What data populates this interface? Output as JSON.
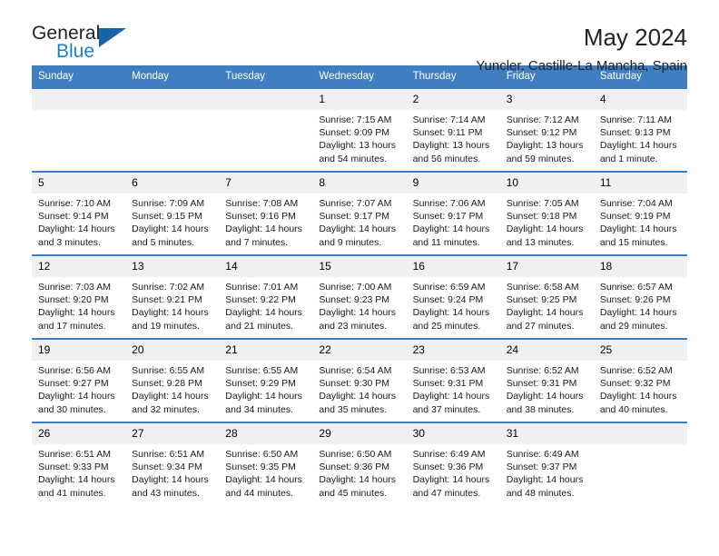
{
  "brand": {
    "name_part1": "General",
    "name_part2": "Blue"
  },
  "header": {
    "title": "May 2024",
    "subtitle": "Yuncler, Castille-La Mancha, Spain"
  },
  "colors": {
    "header_blue": "#3f7fc1",
    "logo_blue": "#1d7fc3",
    "triangle_blue": "#1665ab",
    "daynum_band": "#f0f0f0"
  },
  "calendar": {
    "weekday_headers": [
      "Sunday",
      "Monday",
      "Tuesday",
      "Wednesday",
      "Thursday",
      "Friday",
      "Saturday"
    ],
    "weeks": [
      [
        {
          "day": "",
          "sunrise": "",
          "sunset": "",
          "daylight": "",
          "empty": true
        },
        {
          "day": "",
          "sunrise": "",
          "sunset": "",
          "daylight": "",
          "empty": true
        },
        {
          "day": "",
          "sunrise": "",
          "sunset": "",
          "daylight": "",
          "empty": true
        },
        {
          "day": "1",
          "sunrise": "Sunrise: 7:15 AM",
          "sunset": "Sunset: 9:09 PM",
          "daylight": "Daylight: 13 hours and 54 minutes."
        },
        {
          "day": "2",
          "sunrise": "Sunrise: 7:14 AM",
          "sunset": "Sunset: 9:11 PM",
          "daylight": "Daylight: 13 hours and 56 minutes."
        },
        {
          "day": "3",
          "sunrise": "Sunrise: 7:12 AM",
          "sunset": "Sunset: 9:12 PM",
          "daylight": "Daylight: 13 hours and 59 minutes."
        },
        {
          "day": "4",
          "sunrise": "Sunrise: 7:11 AM",
          "sunset": "Sunset: 9:13 PM",
          "daylight": "Daylight: 14 hours and 1 minute."
        }
      ],
      [
        {
          "day": "5",
          "sunrise": "Sunrise: 7:10 AM",
          "sunset": "Sunset: 9:14 PM",
          "daylight": "Daylight: 14 hours and 3 minutes."
        },
        {
          "day": "6",
          "sunrise": "Sunrise: 7:09 AM",
          "sunset": "Sunset: 9:15 PM",
          "daylight": "Daylight: 14 hours and 5 minutes."
        },
        {
          "day": "7",
          "sunrise": "Sunrise: 7:08 AM",
          "sunset": "Sunset: 9:16 PM",
          "daylight": "Daylight: 14 hours and 7 minutes."
        },
        {
          "day": "8",
          "sunrise": "Sunrise: 7:07 AM",
          "sunset": "Sunset: 9:17 PM",
          "daylight": "Daylight: 14 hours and 9 minutes."
        },
        {
          "day": "9",
          "sunrise": "Sunrise: 7:06 AM",
          "sunset": "Sunset: 9:17 PM",
          "daylight": "Daylight: 14 hours and 11 minutes."
        },
        {
          "day": "10",
          "sunrise": "Sunrise: 7:05 AM",
          "sunset": "Sunset: 9:18 PM",
          "daylight": "Daylight: 14 hours and 13 minutes."
        },
        {
          "day": "11",
          "sunrise": "Sunrise: 7:04 AM",
          "sunset": "Sunset: 9:19 PM",
          "daylight": "Daylight: 14 hours and 15 minutes."
        }
      ],
      [
        {
          "day": "12",
          "sunrise": "Sunrise: 7:03 AM",
          "sunset": "Sunset: 9:20 PM",
          "daylight": "Daylight: 14 hours and 17 minutes."
        },
        {
          "day": "13",
          "sunrise": "Sunrise: 7:02 AM",
          "sunset": "Sunset: 9:21 PM",
          "daylight": "Daylight: 14 hours and 19 minutes."
        },
        {
          "day": "14",
          "sunrise": "Sunrise: 7:01 AM",
          "sunset": "Sunset: 9:22 PM",
          "daylight": "Daylight: 14 hours and 21 minutes."
        },
        {
          "day": "15",
          "sunrise": "Sunrise: 7:00 AM",
          "sunset": "Sunset: 9:23 PM",
          "daylight": "Daylight: 14 hours and 23 minutes."
        },
        {
          "day": "16",
          "sunrise": "Sunrise: 6:59 AM",
          "sunset": "Sunset: 9:24 PM",
          "daylight": "Daylight: 14 hours and 25 minutes."
        },
        {
          "day": "17",
          "sunrise": "Sunrise: 6:58 AM",
          "sunset": "Sunset: 9:25 PM",
          "daylight": "Daylight: 14 hours and 27 minutes."
        },
        {
          "day": "18",
          "sunrise": "Sunrise: 6:57 AM",
          "sunset": "Sunset: 9:26 PM",
          "daylight": "Daylight: 14 hours and 29 minutes."
        }
      ],
      [
        {
          "day": "19",
          "sunrise": "Sunrise: 6:56 AM",
          "sunset": "Sunset: 9:27 PM",
          "daylight": "Daylight: 14 hours and 30 minutes."
        },
        {
          "day": "20",
          "sunrise": "Sunrise: 6:55 AM",
          "sunset": "Sunset: 9:28 PM",
          "daylight": "Daylight: 14 hours and 32 minutes."
        },
        {
          "day": "21",
          "sunrise": "Sunrise: 6:55 AM",
          "sunset": "Sunset: 9:29 PM",
          "daylight": "Daylight: 14 hours and 34 minutes."
        },
        {
          "day": "22",
          "sunrise": "Sunrise: 6:54 AM",
          "sunset": "Sunset: 9:30 PM",
          "daylight": "Daylight: 14 hours and 35 minutes."
        },
        {
          "day": "23",
          "sunrise": "Sunrise: 6:53 AM",
          "sunset": "Sunset: 9:31 PM",
          "daylight": "Daylight: 14 hours and 37 minutes."
        },
        {
          "day": "24",
          "sunrise": "Sunrise: 6:52 AM",
          "sunset": "Sunset: 9:31 PM",
          "daylight": "Daylight: 14 hours and 38 minutes."
        },
        {
          "day": "25",
          "sunrise": "Sunrise: 6:52 AM",
          "sunset": "Sunset: 9:32 PM",
          "daylight": "Daylight: 14 hours and 40 minutes."
        }
      ],
      [
        {
          "day": "26",
          "sunrise": "Sunrise: 6:51 AM",
          "sunset": "Sunset: 9:33 PM",
          "daylight": "Daylight: 14 hours and 41 minutes."
        },
        {
          "day": "27",
          "sunrise": "Sunrise: 6:51 AM",
          "sunset": "Sunset: 9:34 PM",
          "daylight": "Daylight: 14 hours and 43 minutes."
        },
        {
          "day": "28",
          "sunrise": "Sunrise: 6:50 AM",
          "sunset": "Sunset: 9:35 PM",
          "daylight": "Daylight: 14 hours and 44 minutes."
        },
        {
          "day": "29",
          "sunrise": "Sunrise: 6:50 AM",
          "sunset": "Sunset: 9:36 PM",
          "daylight": "Daylight: 14 hours and 45 minutes."
        },
        {
          "day": "30",
          "sunrise": "Sunrise: 6:49 AM",
          "sunset": "Sunset: 9:36 PM",
          "daylight": "Daylight: 14 hours and 47 minutes."
        },
        {
          "day": "31",
          "sunrise": "Sunrise: 6:49 AM",
          "sunset": "Sunset: 9:37 PM",
          "daylight": "Daylight: 14 hours and 48 minutes."
        },
        {
          "day": "",
          "sunrise": "",
          "sunset": "",
          "daylight": "",
          "empty": true
        }
      ]
    ]
  }
}
